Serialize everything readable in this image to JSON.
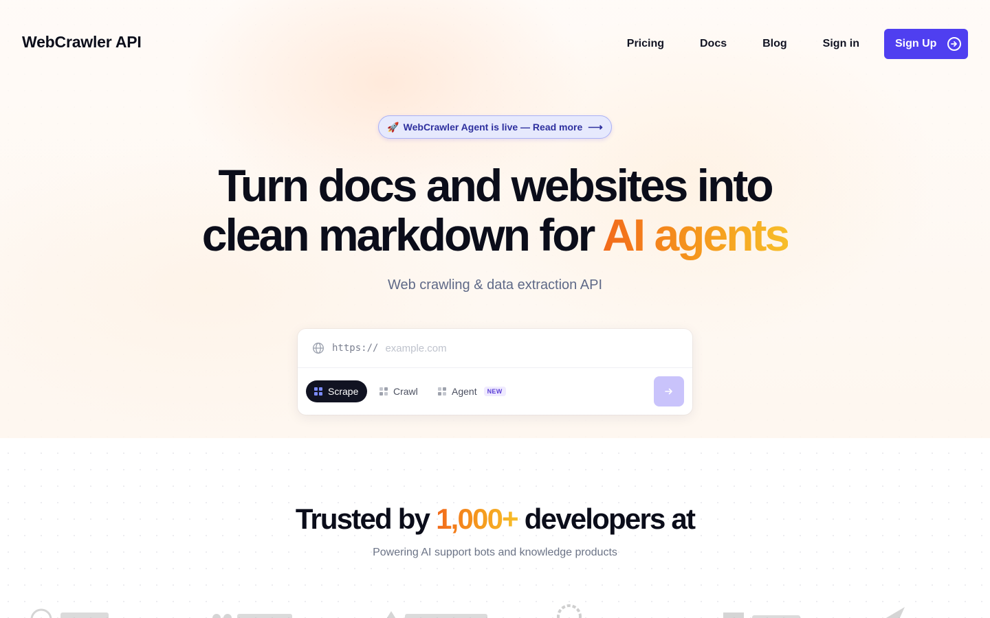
{
  "header": {
    "brand": "WebCrawler API",
    "nav": [
      "Pricing",
      "Docs",
      "Blog",
      "Sign in"
    ],
    "signup_label": "Sign Up"
  },
  "announcement": {
    "text": "WebCrawler Agent is live — Read more",
    "rocket_icon": "🚀",
    "arrow": "⟶"
  },
  "hero": {
    "line1": "Turn docs and websites into",
    "line2_plain": "clean markdown for ",
    "line2_accent": "AI agents",
    "subtitle": "Web crawling & data extraction API"
  },
  "search": {
    "prefix": "https://",
    "placeholder": "example.com",
    "value": "",
    "modes": [
      "Scrape",
      "Crawl",
      "Agent"
    ],
    "active_mode": "Scrape",
    "new_badge": "NEW"
  },
  "trusted": {
    "before": "Trusted by ",
    "count": "1,000+",
    "after": " developers at",
    "subtitle": "Powering AI support bots and knowledge products"
  },
  "colors": {
    "accent": "#4f3ff0",
    "orange": "#f26a1b",
    "gold": "#f7be2a",
    "dark": "#0b0d1a"
  }
}
